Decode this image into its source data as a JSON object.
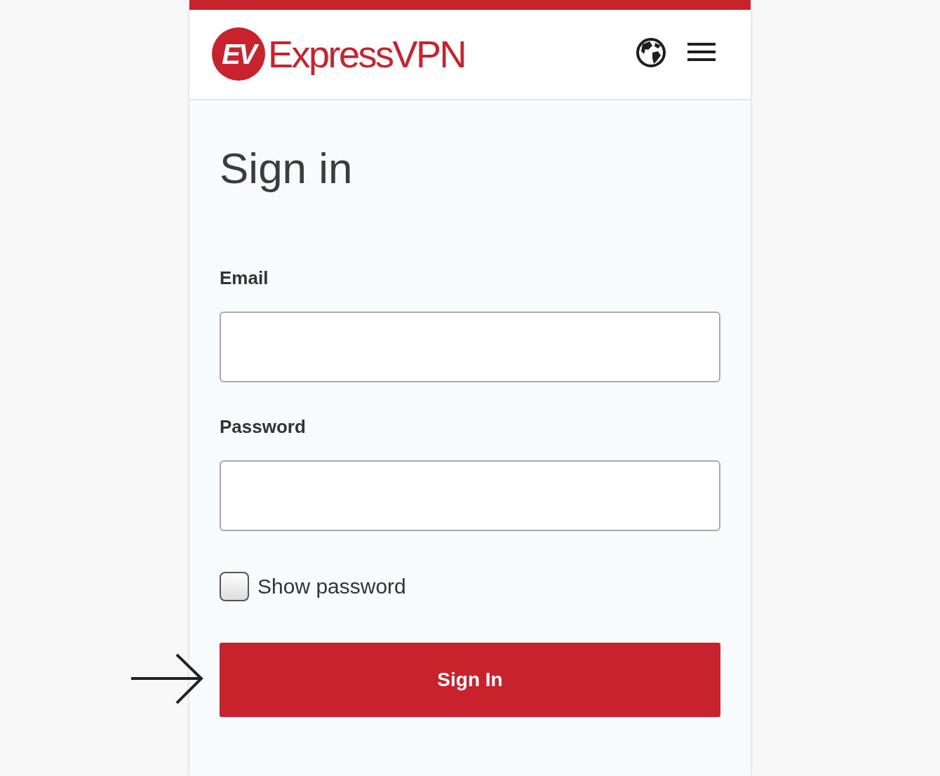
{
  "header": {
    "logo_mark": "EV",
    "brand": "ExpressVPN"
  },
  "heading": "Sign in",
  "fields": [
    {
      "label": "Email"
    },
    {
      "label": "Password"
    }
  ],
  "show_password": {
    "label": "Show password",
    "checked": false
  },
  "submit": "Sign In"
}
